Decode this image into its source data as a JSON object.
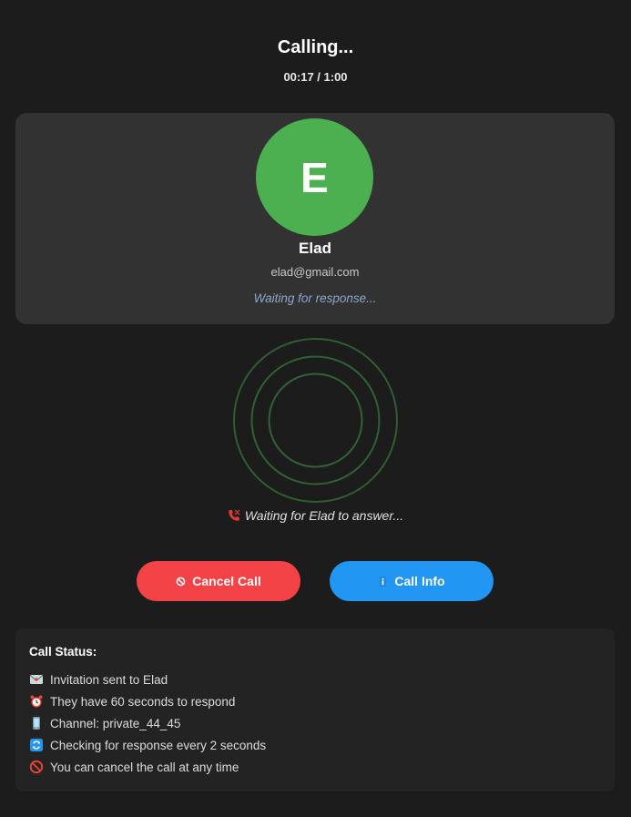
{
  "header": {
    "title": "Calling...",
    "timer": "00:17 / 1:00"
  },
  "contact": {
    "initial": "E",
    "name": "Elad",
    "email": "elad@gmail.com",
    "waiting_text": "Waiting for response...",
    "avatar_color": "#4caf50"
  },
  "calling": {
    "answer_text": "Waiting for Elad to answer...",
    "icon": "phone-icon",
    "ring_color": "#2e5e33"
  },
  "actions": {
    "cancel_label": "Cancel Call",
    "cancel_icon": "no-entry-icon",
    "cancel_color": "#f44346",
    "info_label": "Call Info",
    "info_icon": "info-icon",
    "info_color": "#2196f3"
  },
  "status": {
    "title": "Call Status:",
    "items": [
      {
        "icon": "envelope-icon",
        "text": "Invitation sent to Elad"
      },
      {
        "icon": "alarm-clock-icon",
        "text": "They have 60 seconds to respond"
      },
      {
        "icon": "mobile-phone-icon",
        "text": "Channel: private_44_45"
      },
      {
        "icon": "refresh-icon",
        "text": "Checking for response every 2 seconds"
      },
      {
        "icon": "prohibited-icon",
        "text": "You can cancel the call at any time"
      }
    ]
  }
}
